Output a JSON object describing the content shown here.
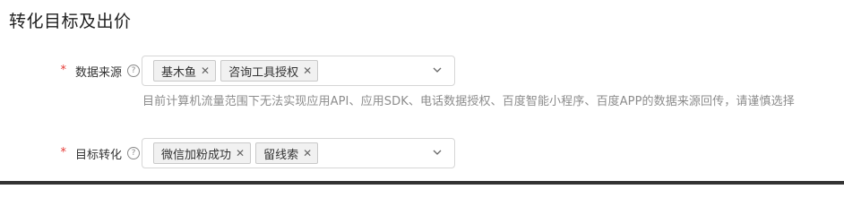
{
  "section": {
    "title": "转化目标及出价"
  },
  "data_source": {
    "required_mark": "*",
    "label": "数据来源",
    "help_icon": "?",
    "tags": [
      {
        "label": "基木鱼",
        "close": "✕"
      },
      {
        "label": "咨询工具授权",
        "close": "✕"
      }
    ],
    "hint": "目前计算机流量范围下无法实现应用API、应用SDK、电话数据授权、百度智能小程序、百度APP的数据来源回传，请谨慎选择"
  },
  "target_conversion": {
    "required_mark": "*",
    "label": "目标转化",
    "help_icon": "?",
    "tags": [
      {
        "label": "微信加粉成功",
        "close": "✕"
      },
      {
        "label": "留线索",
        "close": "✕"
      }
    ]
  },
  "colors": {
    "required": "#e53935",
    "border": "#d6d6d6",
    "tag_bg": "#f1f1f1",
    "hint": "#8c8c8c"
  }
}
